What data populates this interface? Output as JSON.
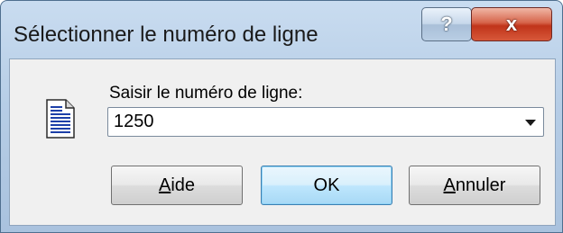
{
  "window": {
    "title": "Sélectionner le numéro de ligne",
    "help_button": "?",
    "close_button": "x"
  },
  "dialog": {
    "prompt": "Saisir le numéro de ligne:",
    "line_number": "1250",
    "icon": "document-icon"
  },
  "buttons": {
    "help": {
      "accel": "A",
      "rest": "ide"
    },
    "ok": "OK",
    "cancel": {
      "accel": "A",
      "rest": "nnuler"
    }
  },
  "colors": {
    "title_glass": "#b6cde6",
    "close_button": "#c0341a",
    "default_button_border": "#3c7fb1",
    "dialog_background": "#f0f0f0"
  }
}
